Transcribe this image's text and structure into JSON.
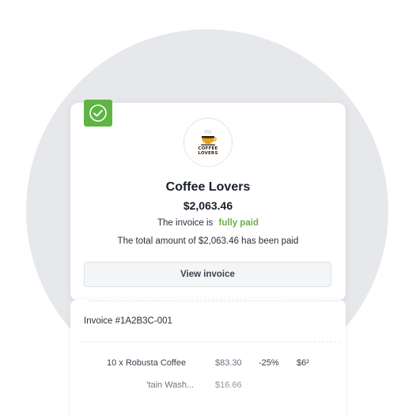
{
  "merchant": {
    "name": "Coffee Lovers",
    "logo_text_line1": "COFFEE",
    "logo_text_line2": "LOVERS"
  },
  "payment": {
    "amount": "$2,063.46",
    "status_prefix": "The invoice is",
    "status_value": "fully paid",
    "total_line": "The total amount of  $2,063.46 has been paid",
    "view_button_label": "View invoice"
  },
  "invoice": {
    "number": "Invoice #1A2B3C-001",
    "items": [
      {
        "description": "10 x Robusta Coffee",
        "price": "$83.30",
        "discount": "-25%",
        "total": "$6²"
      },
      {
        "description": "’tain Wash...",
        "price": "$16.66"
      }
    ]
  },
  "colors": {
    "success": "#5fb544",
    "paid_text": "#6ab04c",
    "background_circle": "#e6e8eb"
  },
  "icons": [
    "check-icon",
    "coffee-cup-icon"
  ]
}
